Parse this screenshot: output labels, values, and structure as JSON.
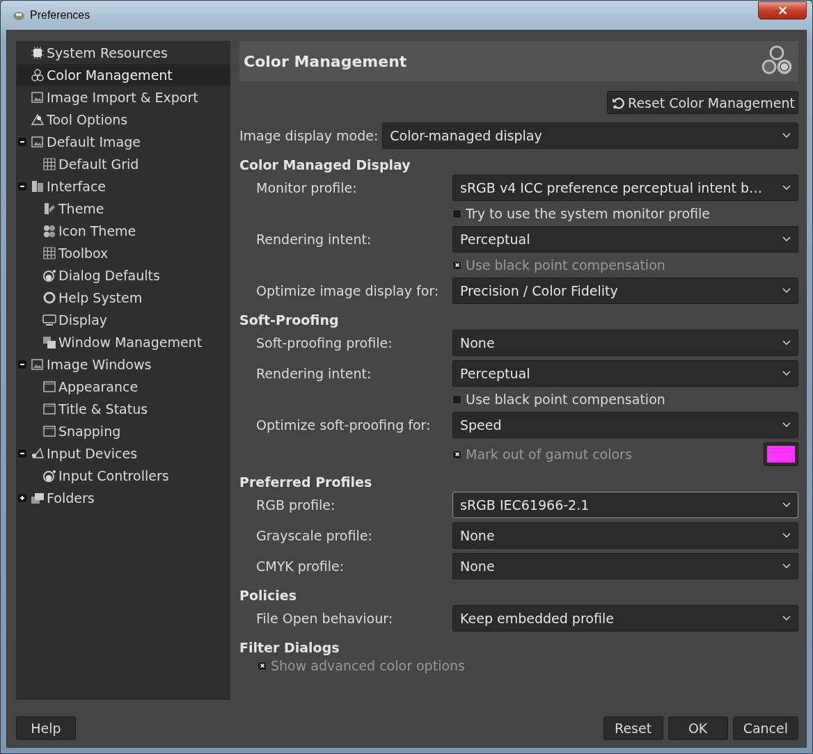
{
  "window": {
    "title": "Preferences"
  },
  "sidebar": {
    "items": [
      {
        "label": "System Resources",
        "selected": false
      },
      {
        "label": "Color Management",
        "selected": true
      },
      {
        "label": "Image Import & Export",
        "selected": false
      },
      {
        "label": "Tool Options",
        "selected": false
      },
      {
        "label": "Default Image",
        "selected": false,
        "expanded": true,
        "children": [
          {
            "label": "Default Grid",
            "selected": false
          }
        ]
      },
      {
        "label": "Interface",
        "selected": false,
        "expanded": true,
        "children": [
          {
            "label": "Theme",
            "selected": false
          },
          {
            "label": "Icon Theme",
            "selected": false
          },
          {
            "label": "Toolbox",
            "selected": false
          },
          {
            "label": "Dialog Defaults",
            "selected": false
          },
          {
            "label": "Help System",
            "selected": false
          },
          {
            "label": "Display",
            "selected": false
          },
          {
            "label": "Window Management",
            "selected": false
          }
        ]
      },
      {
        "label": "Image Windows",
        "selected": false,
        "expanded": true,
        "children": [
          {
            "label": "Appearance",
            "selected": false
          },
          {
            "label": "Title & Status",
            "selected": false
          },
          {
            "label": "Snapping",
            "selected": false
          }
        ]
      },
      {
        "label": "Input Devices",
        "selected": false,
        "expanded": true,
        "children": [
          {
            "label": "Input Controllers",
            "selected": false
          }
        ]
      },
      {
        "label": "Folders",
        "selected": false,
        "expanded": false
      }
    ]
  },
  "page": {
    "title": "Color Management",
    "reset_button": "Reset Color Management",
    "display_mode": {
      "label": "Image display mode:",
      "value": "Color-managed display"
    },
    "sections": [
      {
        "title": "Color Managed Display",
        "rows": [
          {
            "kind": "dropdown",
            "label": "Monitor profile:",
            "value": "sRGB v4 ICC preference perceptual intent b…",
            "focused": false
          },
          {
            "kind": "checkbox",
            "label": "Try to use the system monitor profile",
            "checked": false,
            "disabled": false
          },
          {
            "kind": "dropdown",
            "label": "Rendering intent:",
            "value": "Perceptual",
            "focused": false
          },
          {
            "kind": "checkbox",
            "label": "Use black point compensation",
            "checked": true,
            "disabled": true
          },
          {
            "kind": "dropdown",
            "label": "Optimize image display for:",
            "value": "Precision / Color Fidelity",
            "focused": false
          }
        ]
      },
      {
        "title": "Soft-Proofing",
        "rows": [
          {
            "kind": "dropdown",
            "label": "Soft-proofing profile:",
            "value": "None",
            "focused": false
          },
          {
            "kind": "dropdown",
            "label": "Rendering intent:",
            "value": "Perceptual",
            "focused": false
          },
          {
            "kind": "checkbox",
            "label": "Use black point compensation",
            "checked": false,
            "disabled": false
          },
          {
            "kind": "dropdown",
            "label": "Optimize soft-proofing for:",
            "value": "Speed",
            "focused": false
          },
          {
            "kind": "checkbox_color",
            "label": "Mark out of gamut colors",
            "checked": true,
            "disabled": true,
            "color": "#ff33ff"
          }
        ]
      },
      {
        "title": "Preferred Profiles",
        "rows": [
          {
            "kind": "dropdown",
            "label": "RGB profile:",
            "value": "sRGB IEC61966-2.1",
            "focused": true
          },
          {
            "kind": "dropdown",
            "label": "Grayscale profile:",
            "value": "None",
            "focused": false
          },
          {
            "kind": "dropdown",
            "label": "CMYK profile:",
            "value": "None",
            "focused": false
          }
        ]
      },
      {
        "title": "Policies",
        "rows": [
          {
            "kind": "dropdown",
            "label": "File Open behaviour:",
            "value": "Keep embedded profile",
            "focused": false
          }
        ]
      },
      {
        "title": "Filter Dialogs",
        "rows": [
          {
            "kind": "wide_checkbox",
            "label": "Show advanced color options",
            "checked": true,
            "disabled": true
          }
        ]
      }
    ]
  },
  "buttons": {
    "help": "Help",
    "right": [
      "Reset",
      "OK",
      "Cancel"
    ]
  }
}
